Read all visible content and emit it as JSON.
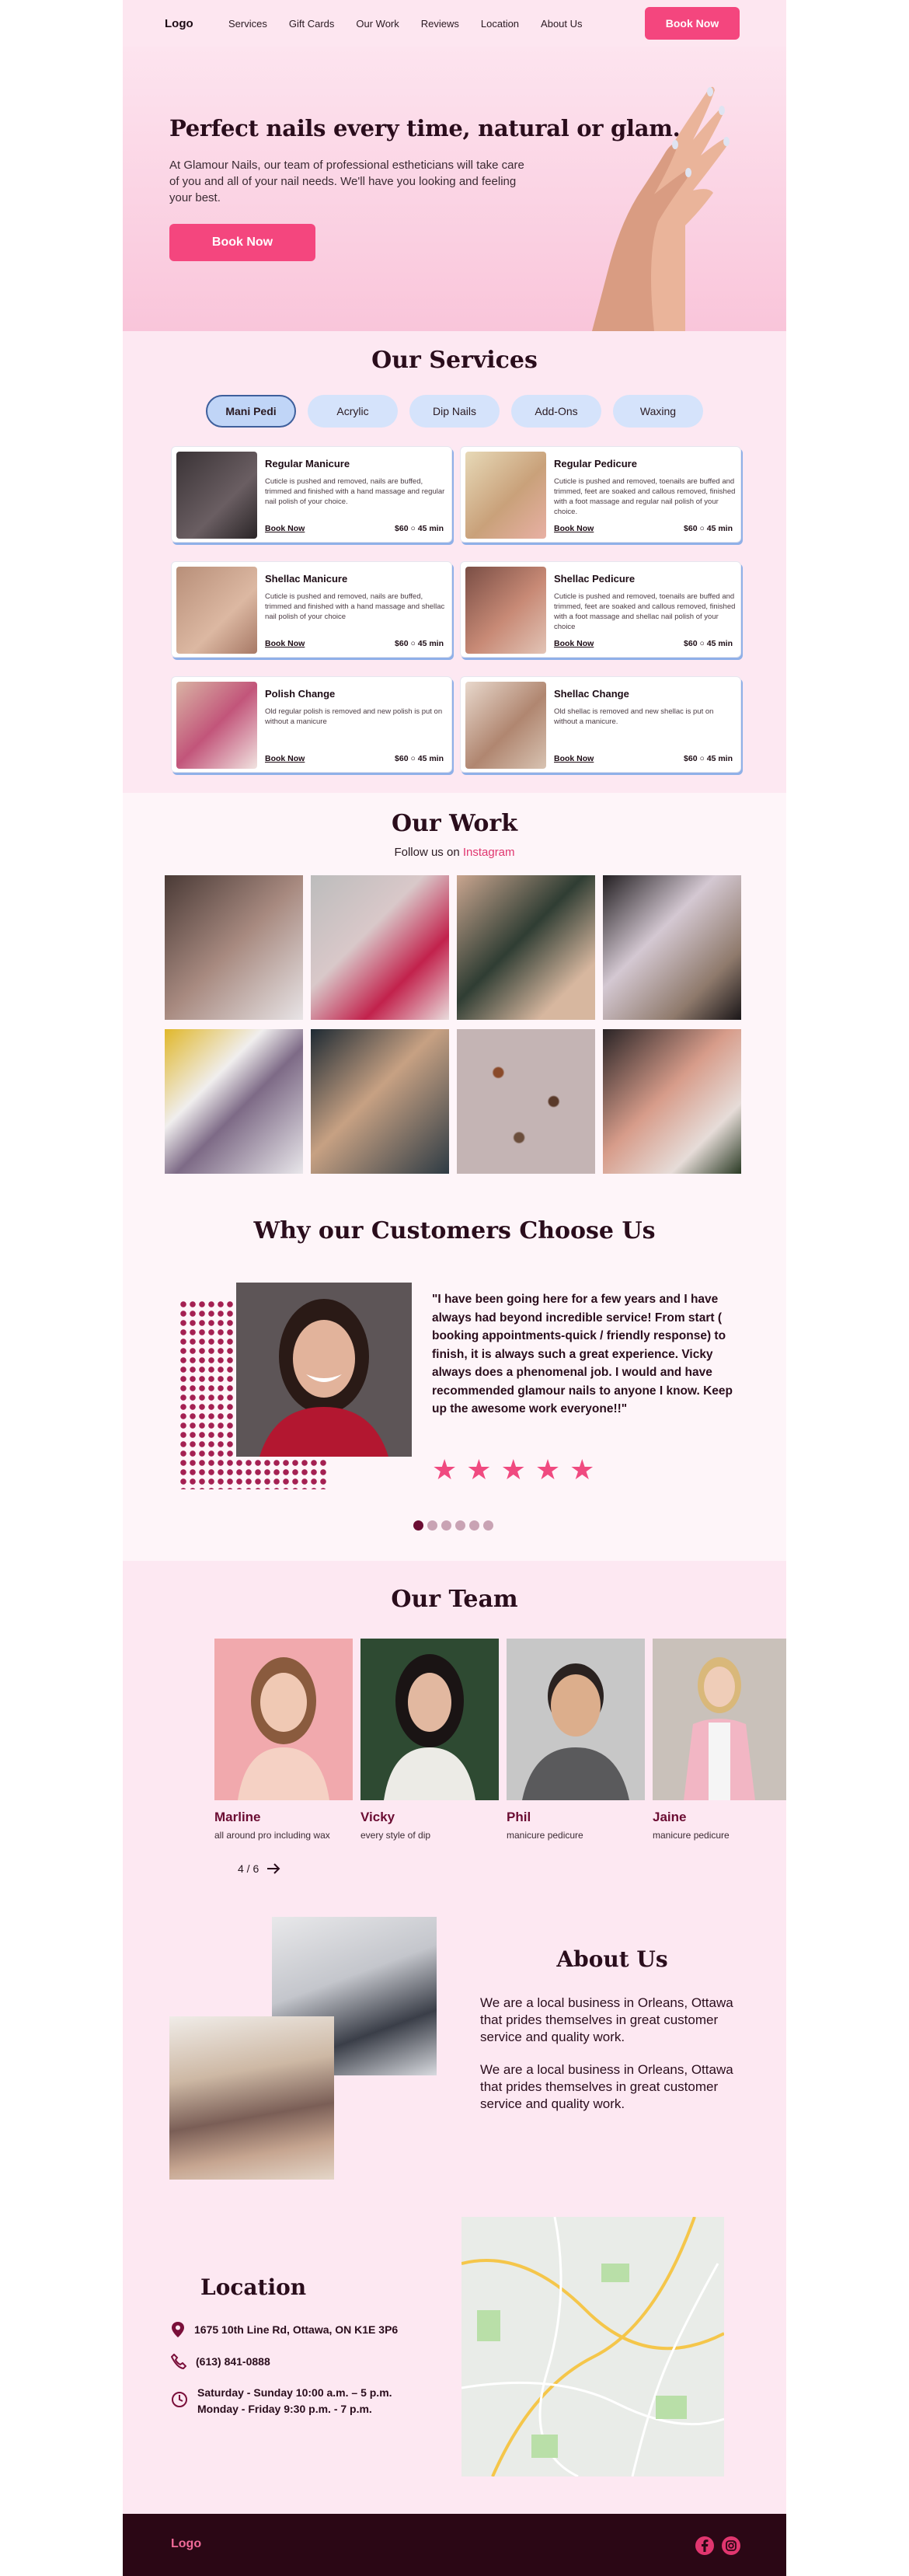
{
  "nav": {
    "logo": "Logo",
    "links": [
      "Services",
      "Gift Cards",
      "Our Work",
      "Reviews",
      "Location",
      "About Us"
    ],
    "cta": "Book Now"
  },
  "hero": {
    "title": "Perfect nails every time, natural or glam.",
    "text": "At Glamour Nails, our team of professional estheticians will take care of you and all of your nail needs. We'll have you looking and feeling your best.",
    "cta": "Book Now"
  },
  "services": {
    "title": "Our Services",
    "tabs": [
      "Mani Pedi",
      "Acrylic",
      "Dip Nails",
      "Add-Ons",
      "Waxing"
    ],
    "active_tab": "Mani Pedi",
    "cards": [
      {
        "name": "Regular Manicure",
        "desc": "Cuticle is pushed and removed, nails are buffed, trimmed and finished with a hand massage and regular nail polish of your choice.",
        "book": "Book Now",
        "price": "$60 ○ 45 min"
      },
      {
        "name": "Regular Pedicure",
        "desc": "Cuticle is pushed and removed, toenails are buffed and trimmed, feet are soaked and callous removed, finished with a foot massage and regular nail polish of your choice.",
        "book": "Book Now",
        "price": "$60 ○ 45 min"
      },
      {
        "name": "Shellac Manicure",
        "desc": "Cuticle is pushed and removed, nails are buffed, trimmed and finished with a hand massage and shellac nail polish of your choice",
        "book": "Book Now",
        "price": "$60 ○ 45 min"
      },
      {
        "name": "Shellac Pedicure",
        "desc": "Cuticle is pushed and removed, toenails are buffed and trimmed, feet are soaked and callous removed, finished with a foot massage and shellac nail polish of your choice",
        "book": "Book Now",
        "price": "$60 ○ 45 min"
      },
      {
        "name": "Polish Change",
        "desc": "Old regular polish is removed and new polish is put on without a manicure",
        "book": "Book Now",
        "price": "$60 ○ 45 min"
      },
      {
        "name": "Shellac Change",
        "desc": "Old shellac is removed and new shellac is put on without a manicure.",
        "book": "Book Now",
        "price": "$60 ○ 45 min"
      }
    ]
  },
  "work": {
    "title": "Our Work",
    "follow_prefix": "Follow us on ",
    "follow_link": "Instagram"
  },
  "reviews": {
    "title": "Why our Customers Choose Us",
    "quote": "\"I have been going here for a few years and I have always had beyond incredible service! From start ( booking appointments-quick / friendly response) to finish, it is always such a great experience. Vicky always does a phenomenal job. I would and have recommended glamour nails to anyone I know. Keep up the awesome work everyone!!\"",
    "rating": 5,
    "pages": 6,
    "current_page": 1
  },
  "team": {
    "title": "Our Team",
    "members": [
      {
        "name": "Marline",
        "role": "all around pro including wax"
      },
      {
        "name": "Vicky",
        "role": "every style of dip"
      },
      {
        "name": "Phil",
        "role": "manicure pedicure"
      },
      {
        "name": "Jaine",
        "role": "manicure pedicure"
      }
    ],
    "counter": "4 / 6"
  },
  "about": {
    "title": "About Us",
    "p1": "We are a local business in Orleans, Ottawa that prides themselves in great customer service and quality work.",
    "p2": "We are a local business in Orleans, Ottawa that prides themselves in great customer service and quality work."
  },
  "location": {
    "title": "Location",
    "address": "1675 10th Line Rd, Ottawa, ON K1E 3P6",
    "phone": "(613) 841-0888",
    "hours1": "Saturday - Sunday 10:00 a.m. – 5 p.m.",
    "hours2": "Monday - Friday 9:30 p.m. - 7 p.m."
  },
  "footer": {
    "logo": "Logo"
  },
  "colors": {
    "accent": "#f4467e",
    "dark": "#2b0715",
    "tab": "#d5e3fb"
  }
}
